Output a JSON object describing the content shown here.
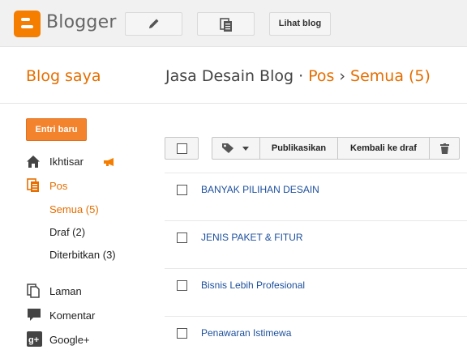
{
  "app": {
    "brand": "Blogger",
    "view_blog_label": "Lihat blog"
  },
  "header": {
    "my_blogs": "Blog saya",
    "blog_name": "Jasa Desain Blog",
    "separator": "·",
    "section": "Pos",
    "arrow": "›",
    "filter": "Semua (5)"
  },
  "sidebar": {
    "new_post": "Entri baru",
    "items": [
      {
        "label": "Ikhtisar",
        "icon": "home-icon"
      },
      {
        "label": "Pos",
        "icon": "posts-icon"
      },
      {
        "label": "Semua (5)"
      },
      {
        "label": "Draf (2)"
      },
      {
        "label": "Diterbitkan (3)"
      },
      {
        "label": "Laman",
        "icon": "page-icon"
      },
      {
        "label": "Komentar",
        "icon": "comment-icon"
      },
      {
        "label": "Google+",
        "icon": "google-plus-icon"
      }
    ]
  },
  "toolbar": {
    "publish": "Publikasikan",
    "revert_draft": "Kembali ke draf"
  },
  "posts": [
    {
      "title": "BANYAK PILIHAN DESAIN"
    },
    {
      "title": "JENIS PAKET & FITUR"
    },
    {
      "title": "Bisnis Lebih Profesional"
    },
    {
      "title": "Penawaran Istimewa"
    }
  ],
  "colors": {
    "accent": "#e56e00",
    "link": "#1c4f9c",
    "button": "#f3832d"
  }
}
